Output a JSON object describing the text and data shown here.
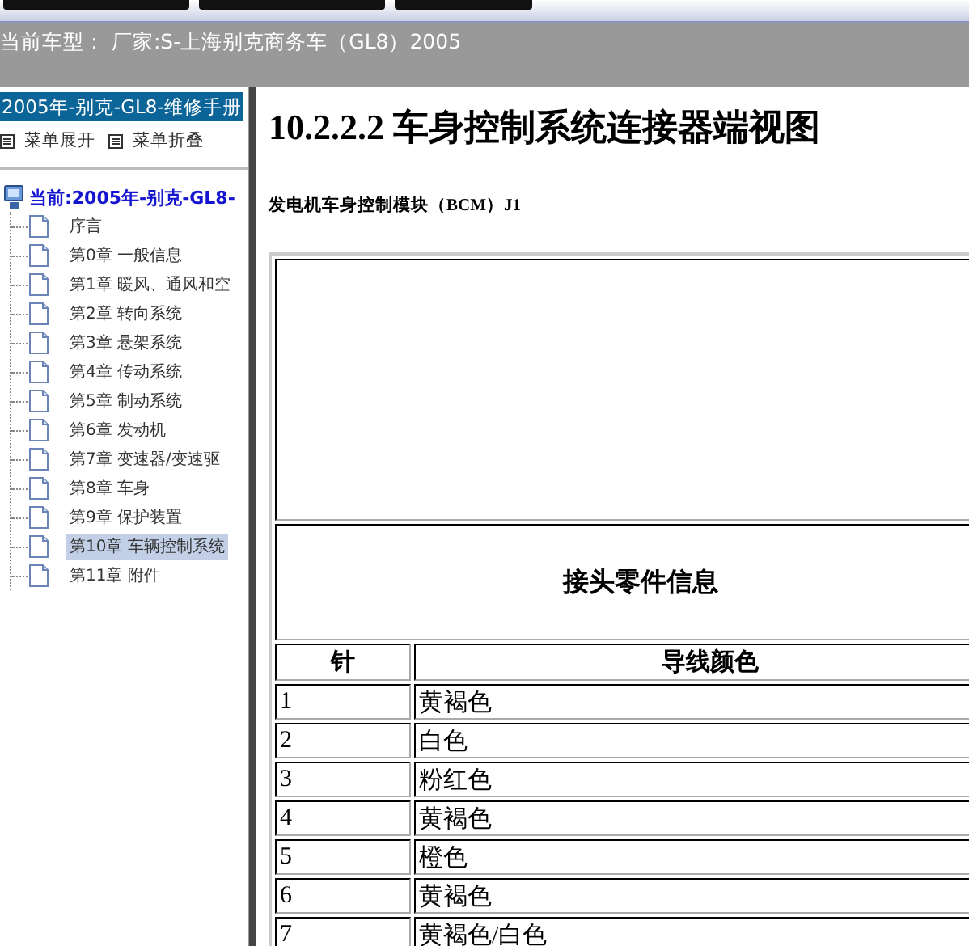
{
  "vehicle_bar": {
    "text": "当前车型： 厂家:S-上海别克商务车（GL8）2005"
  },
  "sidebar": {
    "title": "2005年-别克-GL8-维修手册",
    "actions": [
      "菜单展开",
      "菜单折叠"
    ],
    "tree": {
      "label": "当前:2005年-别克-GL8-",
      "children": [
        {
          "label": "序言",
          "selected": false
        },
        {
          "label": "第0章 一般信息",
          "selected": false
        },
        {
          "label": "第1章 暖风、通风和空",
          "selected": false
        },
        {
          "label": "第2章 转向系统",
          "selected": false
        },
        {
          "label": "第3章 悬架系统",
          "selected": false
        },
        {
          "label": "第4章 传动系统",
          "selected": false
        },
        {
          "label": "第5章 制动系统",
          "selected": false
        },
        {
          "label": "第6章 发动机",
          "selected": false
        },
        {
          "label": "第7章 变速器/变速驱",
          "selected": false
        },
        {
          "label": "第8章 车身",
          "selected": false
        },
        {
          "label": "第9章 保护装置",
          "selected": false
        },
        {
          "label": "第10章 车辆控制系统",
          "selected": true
        },
        {
          "label": "第11章 附件",
          "selected": false
        }
      ]
    }
  },
  "content": {
    "heading": "10.2.2.2 车身控制系统连接器端视图",
    "subheading": "发电机车身控制模块（BCM）J1",
    "table": {
      "info_title": "接头零件信息",
      "columns": [
        "针",
        "导线颜色"
      ],
      "rows": [
        [
          "1",
          "黄褐色"
        ],
        [
          "2",
          "白色"
        ],
        [
          "3",
          "粉红色"
        ],
        [
          "4",
          "黄褐色"
        ],
        [
          "5",
          "橙色"
        ],
        [
          "6",
          "黄褐色"
        ],
        [
          "7",
          "黄褐色/白色"
        ]
      ]
    }
  }
}
